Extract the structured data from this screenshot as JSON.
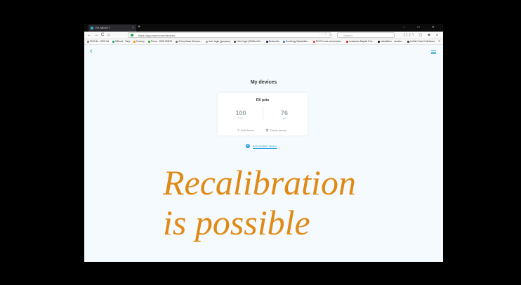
{
  "browser": {
    "tab_title": "RX MEEET",
    "tab_close": "×",
    "new_tab": "+",
    "window_controls": "– □ ✕",
    "nav": {
      "back": "←",
      "forward": "→",
      "reload": "C",
      "home": "⌂"
    },
    "url": "https://app.rxpet.com/devices",
    "url_icons": "··· ♡ ☆",
    "search_placeholder": "Search",
    "toolbar_icons": "|||\\ ▢ ☻ ≡",
    "bookmarks": [
      "SRG 8d - SRG 8d",
      "MRoad - Tarja",
      "Dowrey",
      "Prime - RMS RMRD",
      "A Key Mass Monsoo...",
      "User login (gecpaco)",
      "User login (RMSemPe...",
      "Berkendin",
      "Sociology Backlation...",
      "RCCS code conversion...",
      "Lebanese Baptist Fret...",
      "installation - dovetio...",
      "LaSalt Color Definitions"
    ],
    "bookmarks_more": "»"
  },
  "page": {
    "back_icon": "‹",
    "title": "My devices",
    "device": {
      "name": "RX pets",
      "left_value": "100",
      "left_unit": "FPG",
      "right_value": "76",
      "right_unit": "BP",
      "edit_label": "Edit device",
      "delete_label": "Delete device"
    },
    "add_label": "Add another device"
  },
  "overlay": {
    "line1": "Recalibration",
    "line2": "is possible"
  },
  "colors": {
    "accent": "#2a9fd6",
    "overlay_text": "#e08a16",
    "page_bg": "#f4fafd"
  }
}
